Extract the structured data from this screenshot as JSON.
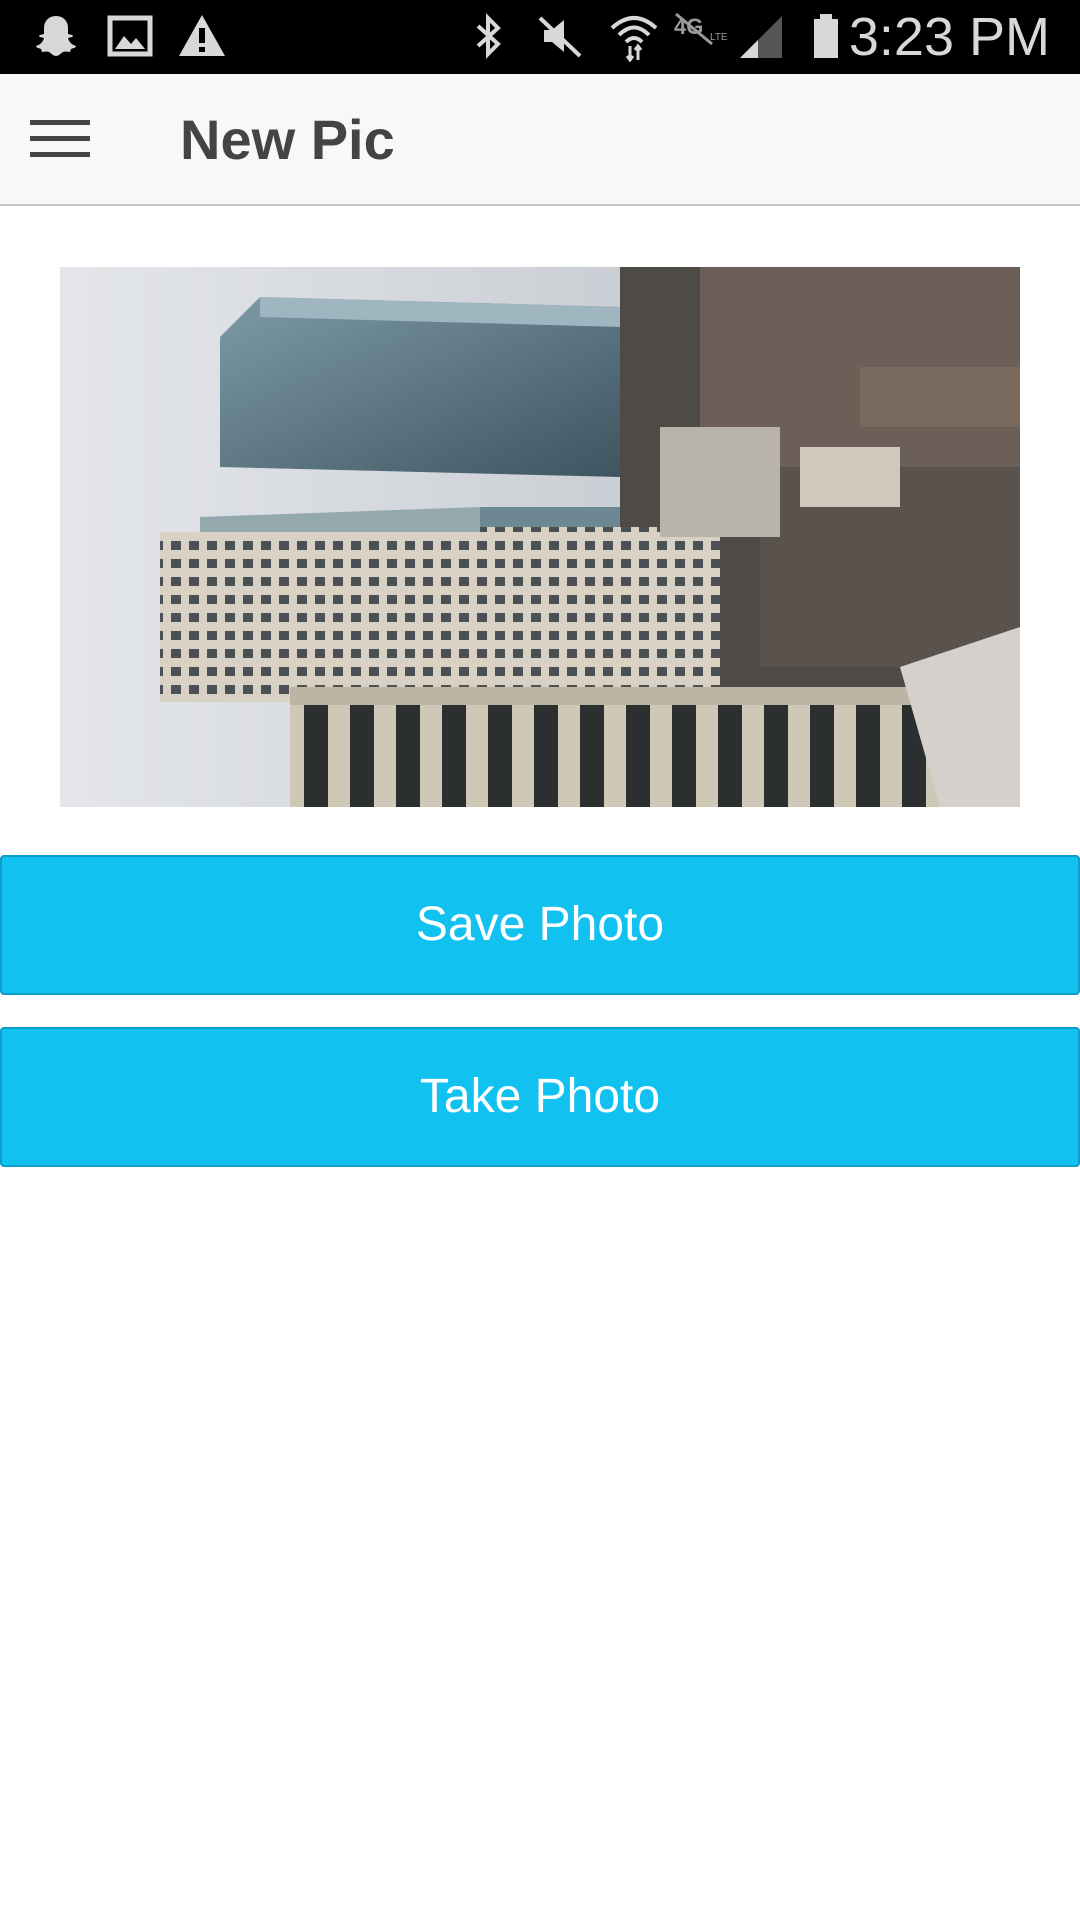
{
  "status_bar": {
    "time": "3:23 PM",
    "icons": [
      "snapchat-icon",
      "gallery-icon",
      "warning-icon",
      "bluetooth-icon",
      "mute-icon",
      "wifi-icon",
      "4g-lte-icon",
      "signal-icon",
      "battery-icon"
    ]
  },
  "app_bar": {
    "title": "New Pic",
    "menu_icon": "hamburger-menu-icon"
  },
  "photo": {
    "description_icon": "photo-preview"
  },
  "buttons": {
    "save_label": "Save Photo",
    "take_label": "Take Photo"
  },
  "colors": {
    "accent": "#11c1f0",
    "status_bar": "#000000",
    "app_bar": "#f8f8f8"
  }
}
